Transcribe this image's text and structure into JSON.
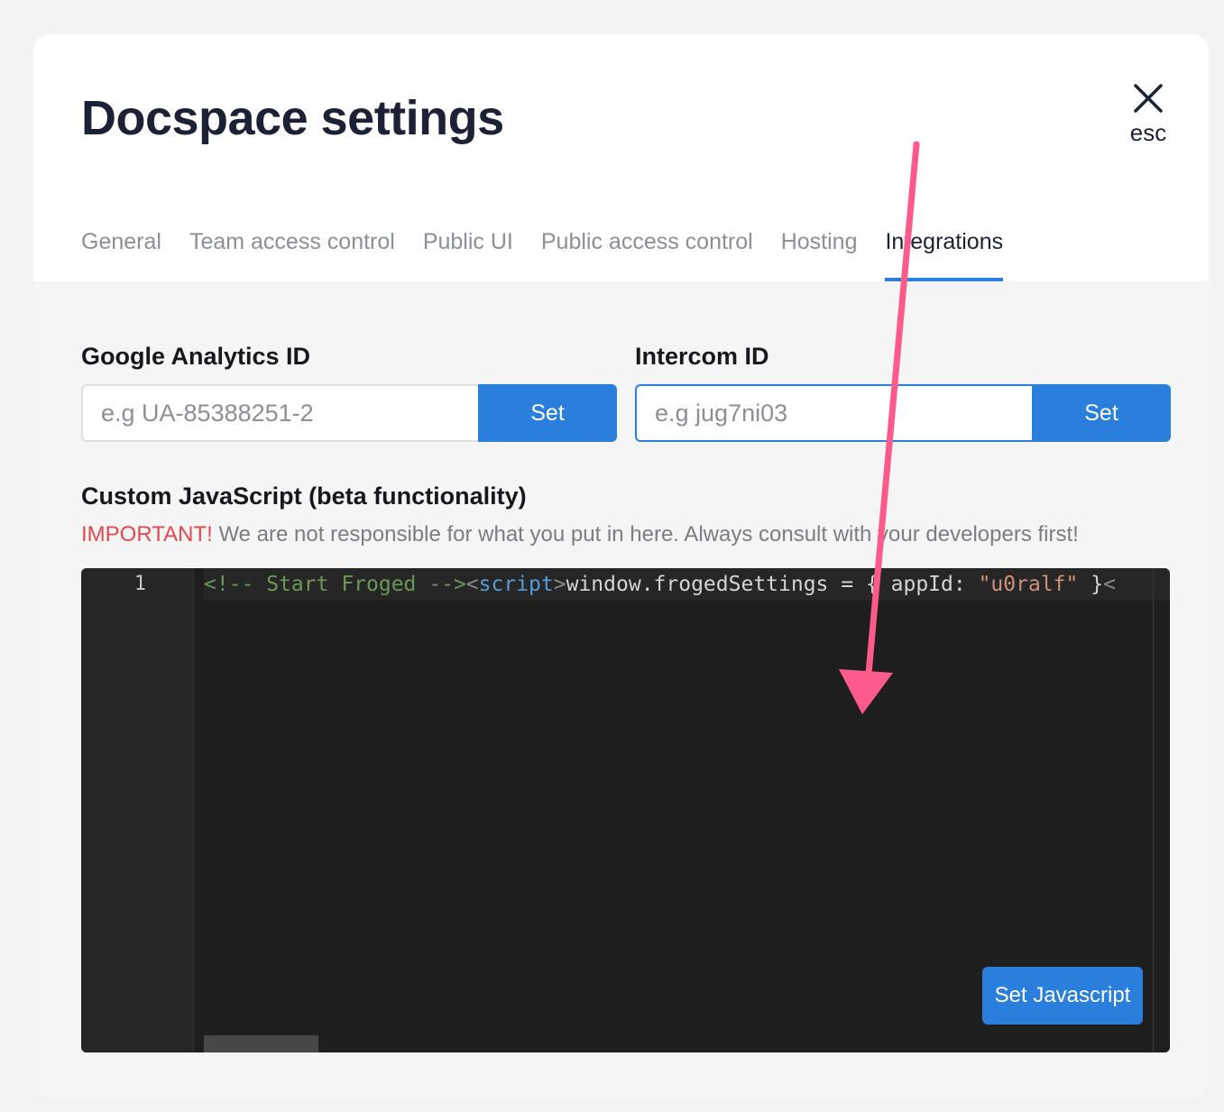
{
  "modal": {
    "title": "Docspace settings",
    "close_label": "esc"
  },
  "tabs": [
    {
      "label": "General",
      "active": false
    },
    {
      "label": "Team access control",
      "active": false
    },
    {
      "label": "Public UI",
      "active": false
    },
    {
      "label": "Public access control",
      "active": false
    },
    {
      "label": "Hosting",
      "active": false
    },
    {
      "label": "Integrations",
      "active": true
    }
  ],
  "integrations": {
    "google_analytics": {
      "label": "Google Analytics ID",
      "placeholder": "e.g UA-85388251-2",
      "value": "",
      "button_label": "Set"
    },
    "intercom": {
      "label": "Intercom ID",
      "placeholder": "e.g jug7ni03",
      "value": "",
      "button_label": "Set"
    },
    "custom_js": {
      "title": "Custom JavaScript (beta functionality)",
      "warning_important": "IMPORTANT!",
      "warning_text": " We are not responsible for what you put in here. Always consult with your developers first!",
      "line_number": "1",
      "code_tokens": [
        {
          "type": "comment",
          "text": "<!-- Start Froged -->"
        },
        {
          "type": "punct",
          "text": "<"
        },
        {
          "type": "tag",
          "text": "script"
        },
        {
          "type": "punct",
          "text": ">"
        },
        {
          "type": "text",
          "text": "window.frogedSettings = { appId: "
        },
        {
          "type": "string",
          "text": "\"u0ralf\""
        },
        {
          "type": "text",
          "text": " }"
        },
        {
          "type": "punct",
          "text": "<"
        }
      ],
      "button_label": "Set Javascript"
    }
  },
  "colors": {
    "accent": "#2a7fdd",
    "important": "#e5484d",
    "annotation_arrow": "#ff5a8c"
  },
  "icons": {
    "close": "close-icon",
    "annotation": "annotation-arrow"
  }
}
